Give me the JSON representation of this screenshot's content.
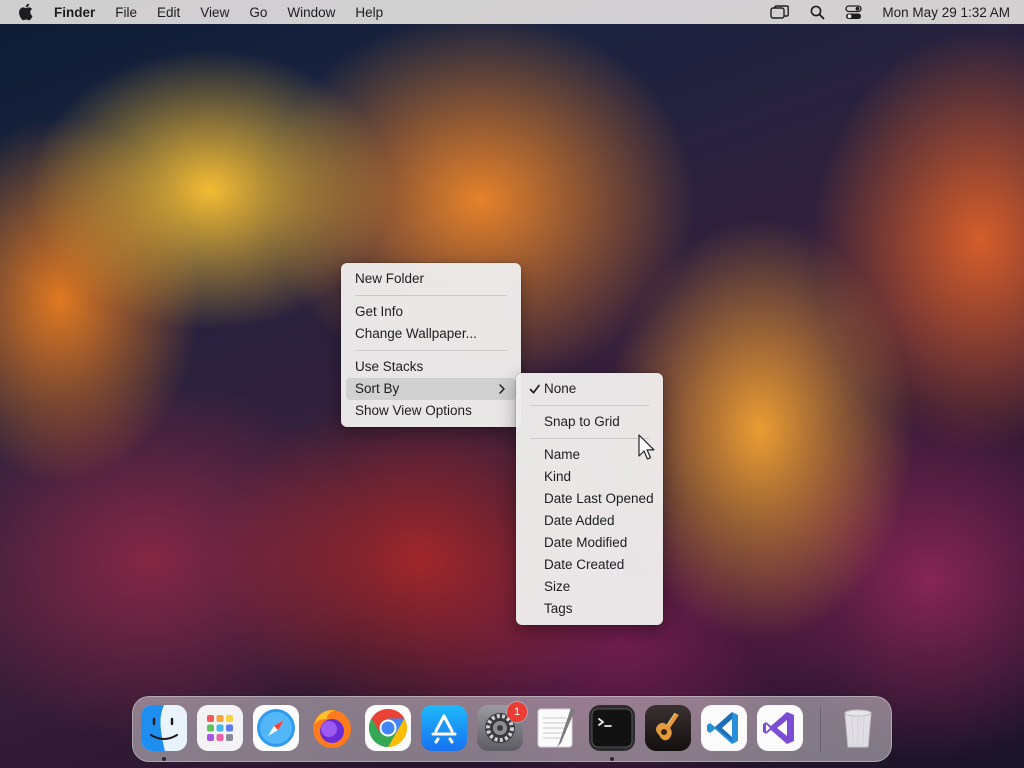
{
  "menubar": {
    "app_name": "Finder",
    "items": [
      "File",
      "Edit",
      "View",
      "Go",
      "Window",
      "Help"
    ],
    "clock": "Mon May 29  1:32 AM",
    "icons": [
      "apple-icon",
      "screen-mirroring-icon",
      "spotlight-search-icon",
      "control-center-icon"
    ]
  },
  "context_menu": {
    "new_folder": "New Folder",
    "get_info": "Get Info",
    "change_wallpaper": "Change Wallpaper...",
    "use_stacks": "Use Stacks",
    "sort_by": "Sort By",
    "show_view_options": "Show View Options"
  },
  "sort_submenu": {
    "none": "None",
    "snap_to_grid": "Snap to Grid",
    "name": "Name",
    "kind": "Kind",
    "date_last_opened": "Date Last Opened",
    "date_added": "Date Added",
    "date_modified": "Date Modified",
    "date_created": "Date Created",
    "size": "Size",
    "tags": "Tags",
    "checked": "None"
  },
  "dock": {
    "apps": [
      "finder-icon",
      "launchpad-icon",
      "safari-icon",
      "firefox-icon",
      "chrome-icon",
      "app-store-icon",
      "system-settings-icon",
      "textedit-icon",
      "terminal-icon",
      "garageband-icon",
      "vscode-icon",
      "visual-studio-icon",
      "trash-icon"
    ],
    "settings_badge": "1",
    "running": [
      "finder-icon",
      "terminal-icon"
    ]
  }
}
